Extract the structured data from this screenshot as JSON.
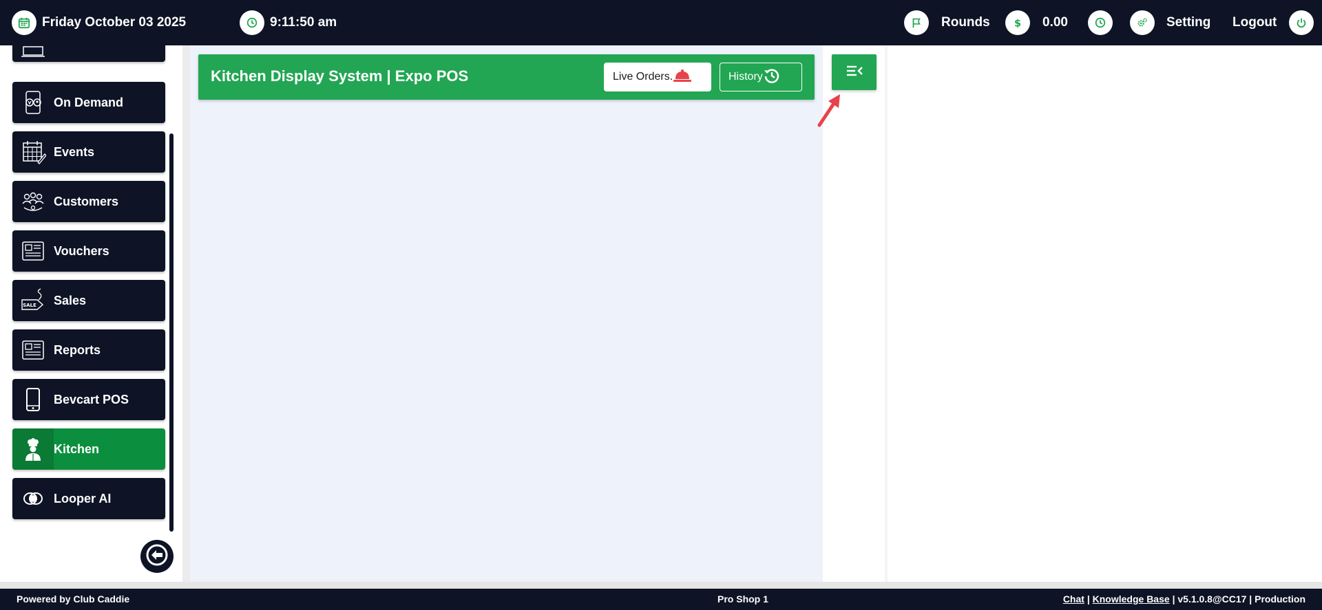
{
  "topbar": {
    "date": "Friday October 03 2025",
    "time": "9:11:50 am",
    "rounds_label": "Rounds",
    "balance": "0.00",
    "setting_label": "Setting",
    "logout_label": "Logout"
  },
  "sidebar": {
    "items": [
      {
        "label": "On Demand",
        "icon": "phone-people-icon"
      },
      {
        "label": "Events",
        "icon": "calendar-edit-icon"
      },
      {
        "label": "Customers",
        "icon": "customers-icon"
      },
      {
        "label": "Vouchers",
        "icon": "newspaper-icon"
      },
      {
        "label": "Sales",
        "icon": "sale-tag-icon"
      },
      {
        "label": "Reports",
        "icon": "report-icon"
      },
      {
        "label": "Bevcart POS",
        "icon": "mobile-icon"
      },
      {
        "label": "Kitchen",
        "icon": "chef-icon",
        "active": true
      },
      {
        "label": "Looper AI",
        "icon": "looper-icon"
      }
    ]
  },
  "main": {
    "title": "Kitchen Display System | Expo POS",
    "live_orders_label": "Live Orders.",
    "history_label": "History"
  },
  "footer": {
    "powered_by": "Powered by Club Caddie",
    "location": "Pro Shop 1",
    "chat_label": "Chat",
    "kb_label": "Knowledge Base",
    "version_text": "| v5.1.0.8@CC17 | Production",
    "sep": "|"
  },
  "colors": {
    "navy": "#0e1426",
    "green": "#22a653",
    "active_green": "#0b8f3e",
    "arrow_red": "#e8424a"
  }
}
